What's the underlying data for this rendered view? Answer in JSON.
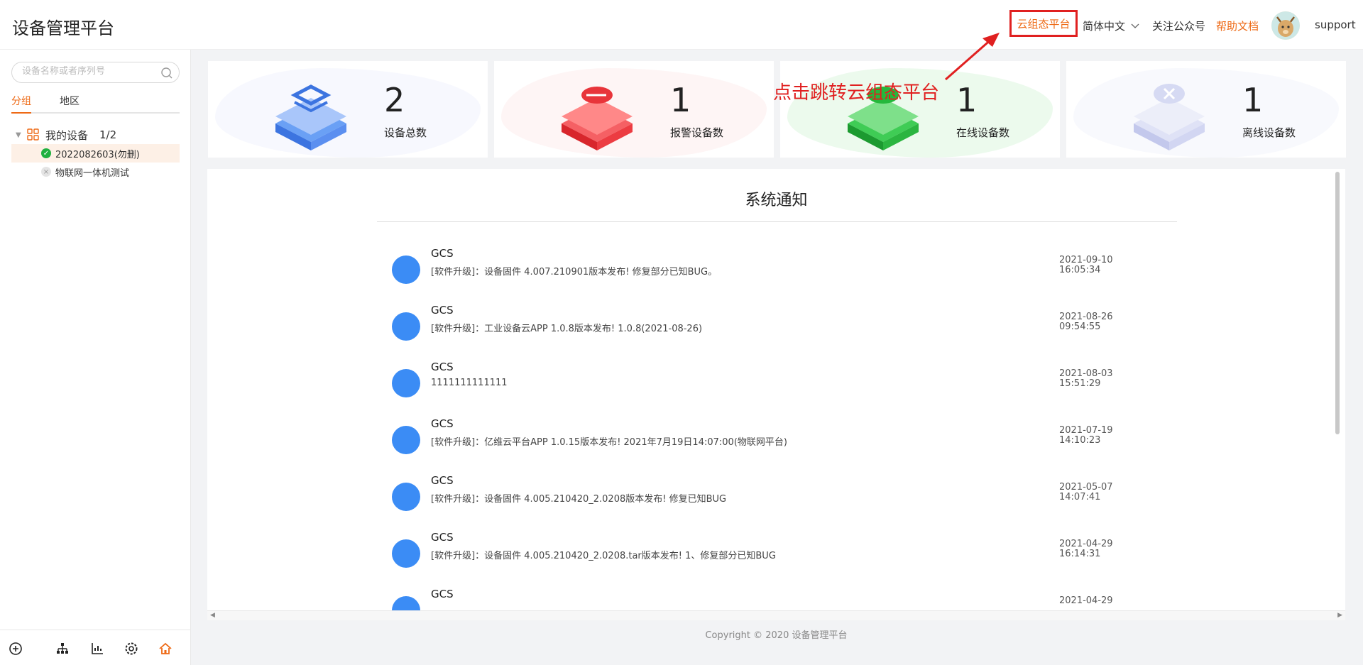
{
  "header": {
    "title": "设备管理平台",
    "cloud_link": "云组态平台",
    "language": "简体中文",
    "follow": "关注公众号",
    "help": "帮助文档",
    "user": "support"
  },
  "sidebar": {
    "search_placeholder": "设备名称或者序列号",
    "tabs": [
      "分组",
      "地区"
    ],
    "tree": {
      "root_label": "我的设备",
      "root_count": "1/2",
      "items": [
        {
          "label": "2022082603(勿删)",
          "status": "online"
        },
        {
          "label": "物联网一体机测试",
          "status": "offline"
        }
      ]
    }
  },
  "stats": [
    {
      "value": "2",
      "label": "设备总数",
      "color": "#4a86f0"
    },
    {
      "value": "1",
      "label": "报警设备数",
      "color": "#f0343a"
    },
    {
      "value": "1",
      "label": "在线设备数",
      "color": "#25b83c"
    },
    {
      "value": "1",
      "label": "离线设备数",
      "color": "#c9cdf0"
    }
  ],
  "notice": {
    "title": "系统通知",
    "messages": [
      {
        "from": "GCS",
        "text": "[软件升级]：设备固件 4.007.210901版本发布! 修复部分已知BUG。",
        "date": "2021-09-10",
        "time": "16:05:34"
      },
      {
        "from": "GCS",
        "text": "[软件升级]：工业设备云APP 1.0.8版本发布! 1.0.8(2021-08-26)",
        "date": "2021-08-26",
        "time": "09:54:55"
      },
      {
        "from": "GCS",
        "text": "1111111111111",
        "date": "2021-08-03",
        "time": "15:51:29"
      },
      {
        "from": "GCS",
        "text": "[软件升级]：亿维云平台APP 1.0.15版本发布! 2021年7月19日14:07:00(物联网平台)",
        "date": "2021-07-19",
        "time": "14:10:23"
      },
      {
        "from": "GCS",
        "text": "[软件升级]：设备固件 4.005.210420_2.0208版本发布! 修复已知BUG",
        "date": "2021-05-07",
        "time": "14:07:41"
      },
      {
        "from": "GCS",
        "text": "[软件升级]：设备固件 4.005.210420_2.0208.tar版本发布! 1、修复部分已知BUG",
        "date": "2021-04-29",
        "time": "16:14:31"
      },
      {
        "from": "GCS",
        "text": "",
        "date": "2021-04-29",
        "time": ""
      }
    ]
  },
  "footer": {
    "copyright": "Copyright © 2020 设备管理平台"
  },
  "annotation": {
    "text": "点击跳转云组态平台"
  }
}
